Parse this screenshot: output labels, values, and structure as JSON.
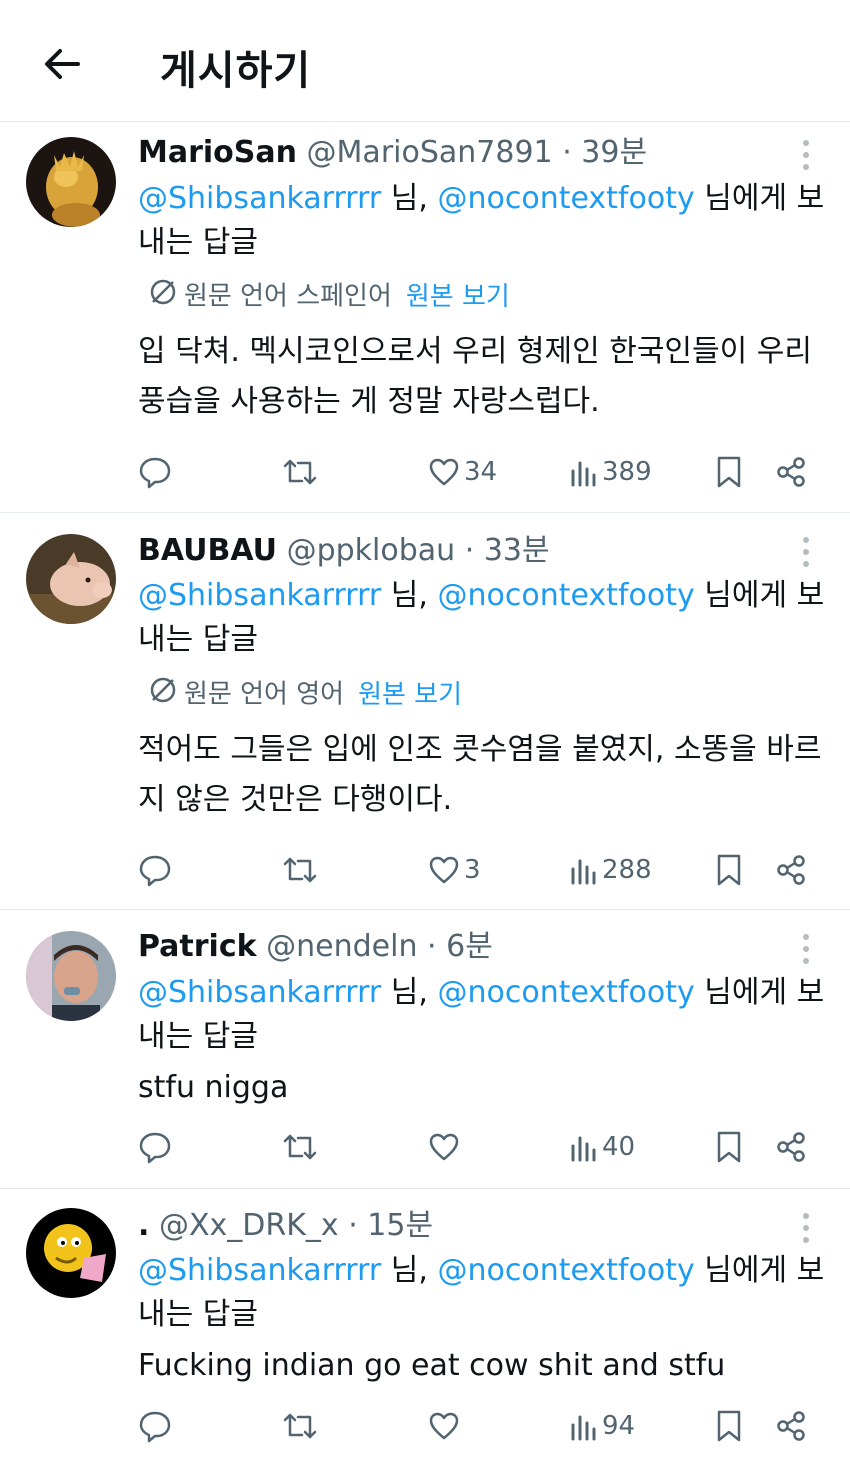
{
  "header": {
    "title": "게시하기"
  },
  "posts": [
    {
      "name": "MarioSan",
      "handle": "@MarioSan7891",
      "dot": "·",
      "time": "39분",
      "reply_mention_1": "@Shibsankarrrrr",
      "reply_sep": " 님, ",
      "reply_mention_2": "@nocontextfooty",
      "reply_suffix": " 님에게 보내는 답글",
      "translate_label": "원문 언어 스페인어",
      "show_original": "원본 보기",
      "text": "입 닥쳐. 멕시코인으로서 우리 형제인 한국인들이 우리 풍습을 사용하는 게 정말 자랑스럽다.",
      "likes": "34",
      "views": "389"
    },
    {
      "name": "BAUBAU",
      "handle": "@ppklobau",
      "dot": "·",
      "time": "33분",
      "reply_mention_1": "@Shibsankarrrrr",
      "reply_sep": " 님, ",
      "reply_mention_2": "@nocontextfooty",
      "reply_suffix": " 님에게 보내는 답글",
      "translate_label": "원문 언어 영어",
      "show_original": "원본 보기",
      "text": "적어도 그들은 입에 인조 콧수염을 붙였지, 소똥을 바르지 않은 것만은 다행이다.",
      "likes": "3",
      "views": "288"
    },
    {
      "name": "Patrick",
      "handle": "@nendeln",
      "dot": "·",
      "time": "6분",
      "reply_mention_1": "@Shibsankarrrrr",
      "reply_sep": " 님, ",
      "reply_mention_2": "@nocontextfooty",
      "reply_suffix": " 님에게 보내는 답글",
      "text": "stfu nigga",
      "likes": "",
      "views": "40"
    },
    {
      "name": ".",
      "handle": "@Xx_DRK_x",
      "dot": "·",
      "time": "15분",
      "reply_mention_1": "@Shibsankarrrrr",
      "reply_sep": " 님, ",
      "reply_mention_2": "@nocontextfooty",
      "reply_suffix": " 님에게 보내는 답글",
      "text": "Fucking indian go eat cow shit and stfu",
      "likes": "",
      "views": "94"
    }
  ]
}
